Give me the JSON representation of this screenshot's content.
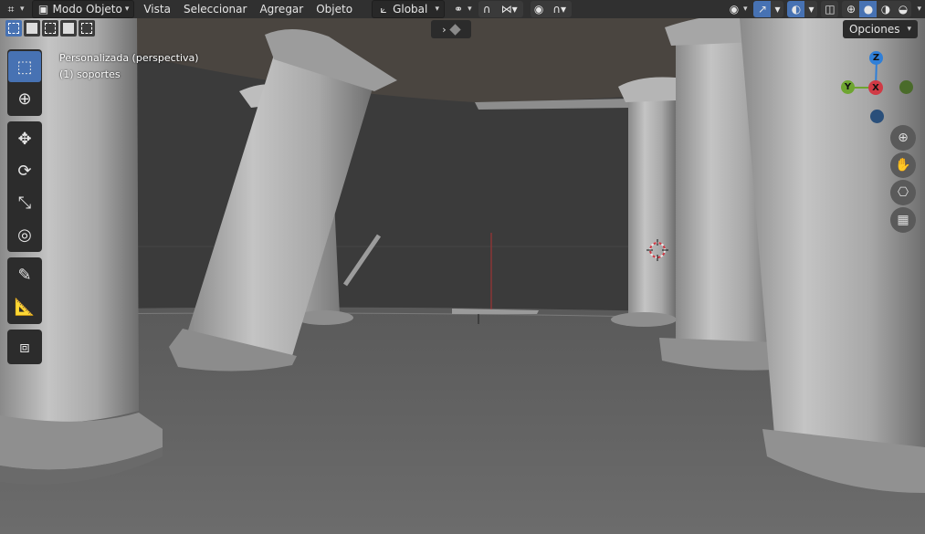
{
  "header": {
    "editor_type_icon": "editor-type-icon",
    "mode": {
      "label": "Modo Objeto"
    },
    "menus": [
      "Vista",
      "Seleccionar",
      "Agregar",
      "Objeto"
    ],
    "transform_orientation": {
      "label": "Global"
    },
    "pivot_icon": "pivot-icon",
    "snap_icon": "snap-magnet-icon",
    "proportional_icon": "proportional-edit-icon",
    "visibility_icon": "visibility-eye-icon",
    "gizmo_icon": "gizmo-icon",
    "overlay_icon": "overlay-icon",
    "xray_icon": "xray-icon",
    "shading": {
      "modes": [
        "wireframe",
        "solid",
        "material",
        "rendered"
      ],
      "active": "solid"
    }
  },
  "select_modes": [
    "new",
    "extend",
    "subtract",
    "invert",
    "intersect"
  ],
  "toolbar": {
    "groups": [
      [
        "select-box",
        "cursor"
      ],
      [
        "move",
        "rotate",
        "scale",
        "transform"
      ],
      [
        "annotate",
        "measure"
      ],
      [
        "add-cube"
      ]
    ],
    "active": "select-box"
  },
  "viewport": {
    "view_name": "Personalizada (perspectiva)",
    "object_name": "(1) soportes",
    "options_label": "Opciones"
  },
  "gizmo": {
    "axes": [
      {
        "label": "Z",
        "color": "#2f7fd8"
      },
      {
        "label": "Y",
        "color": "#6ea530"
      },
      {
        "label": "X",
        "color": "#d03a45"
      }
    ]
  },
  "nav_buttons": [
    "zoom-icon",
    "pan-hand-icon",
    "camera-icon",
    "grid-view-icon"
  ],
  "colors": {
    "accent": "#4772b3",
    "header_bg": "#303030",
    "floor": "#6e6e6e",
    "column_light": "#b4b4b4"
  }
}
